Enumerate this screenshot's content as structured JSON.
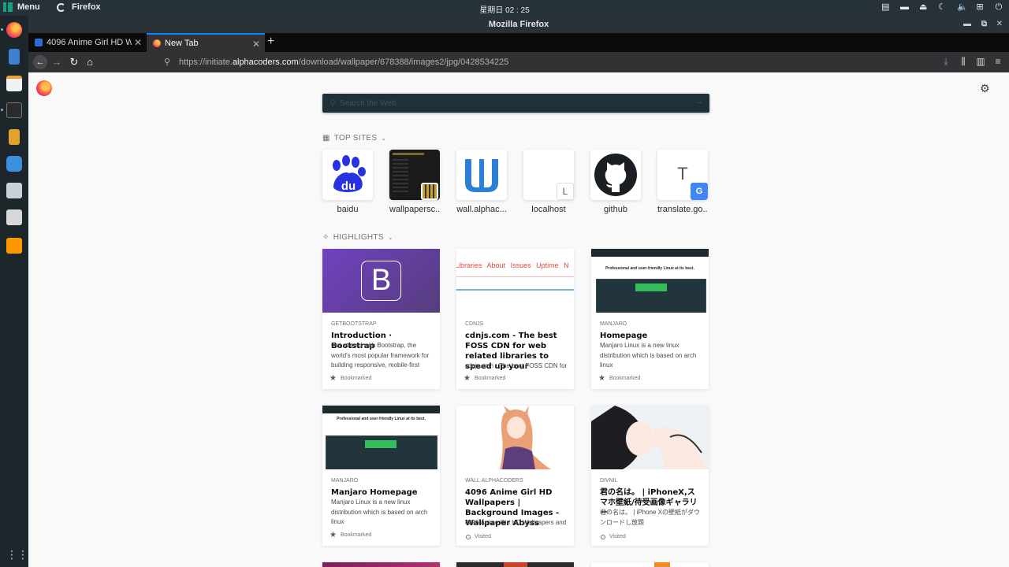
{
  "panel": {
    "menu_label": "Menu",
    "app_label": "Firefox",
    "clock": "星期日 02 : 25"
  },
  "window": {
    "title": "Mozilla Firefox"
  },
  "tabs": [
    {
      "title": "4096 Anime Girl HD Wa",
      "active": false
    },
    {
      "title": "New Tab",
      "active": true
    }
  ],
  "urlbar": {
    "prefix": "https://initiate.",
    "host": "alphacoders.com",
    "path": "/download/wallpaper/678388/images2/jpg/0428534225"
  },
  "search": {
    "placeholder": "Search the Web"
  },
  "top_sites": {
    "heading": "TOP SITES",
    "items": [
      {
        "label": "baidu",
        "tile_text": "du"
      },
      {
        "label": "wallpapersc..."
      },
      {
        "label": "wall.alphac..."
      },
      {
        "label": "localhost",
        "tile_text": "L"
      },
      {
        "label": "github"
      },
      {
        "label": "translate.go...",
        "tile_text": "T"
      }
    ]
  },
  "highlights": {
    "heading": "HIGHLIGHTS",
    "cards": [
      {
        "host": "GETBOOTSTRAP",
        "title": "Introduction · Bootstrap",
        "desc": "Get started with Bootstrap, the world's most popular framework for building responsive, mobile-first",
        "context": "Bookmarked"
      },
      {
        "host": "CDNJS",
        "title": "cdnjs.com - The best FOSS CDN for web related libraries to speed up your",
        "desc": "cdnjs.com - The best FOSS CDN for",
        "context": "Bookmarked",
        "preview_links": [
          "Libraries",
          "About",
          "Issues",
          "Uptime",
          "N"
        ]
      },
      {
        "host": "MANJARO",
        "title": "Homepage",
        "desc": "Manjaro Linux is a new linux distribution which is based on arch linux",
        "context": "Bookmarked"
      },
      {
        "host": "MANJARO",
        "title": "Manjaro Homepage",
        "desc": "Manjaro Linux is a new linux distribution which is based on arch linux",
        "context": "Bookmarked"
      },
      {
        "host": "WALL.ALPHACODERS",
        "title": "4096 Anime Girl HD Wallpapers | Background Images - Wallpaper Abyss",
        "desc": "4096 Anime Girl HD Wallpapers and",
        "context": "Visited"
      },
      {
        "host": "DIVNIL",
        "title": "君の名は。 | iPhoneX,スマホ壁紙/待受画像ギャラリー",
        "desc": "君の名は。 | iPhone Xの壁紙がダウンロードし放題",
        "context": "Visited"
      }
    ]
  },
  "colors": {
    "accent": "#0a84ff",
    "bootstrap": "#563d7c",
    "manjaro": "#35bf5c",
    "search_bg": "#20303a"
  },
  "icons": [
    "manjaro-menu-icon",
    "firefox-icon",
    "gear-icon",
    "search-icon",
    "reload-icon",
    "home-icon",
    "download-icon",
    "library-icon",
    "sidebar-icon",
    "hamburger-menu-icon",
    "star-icon"
  ]
}
